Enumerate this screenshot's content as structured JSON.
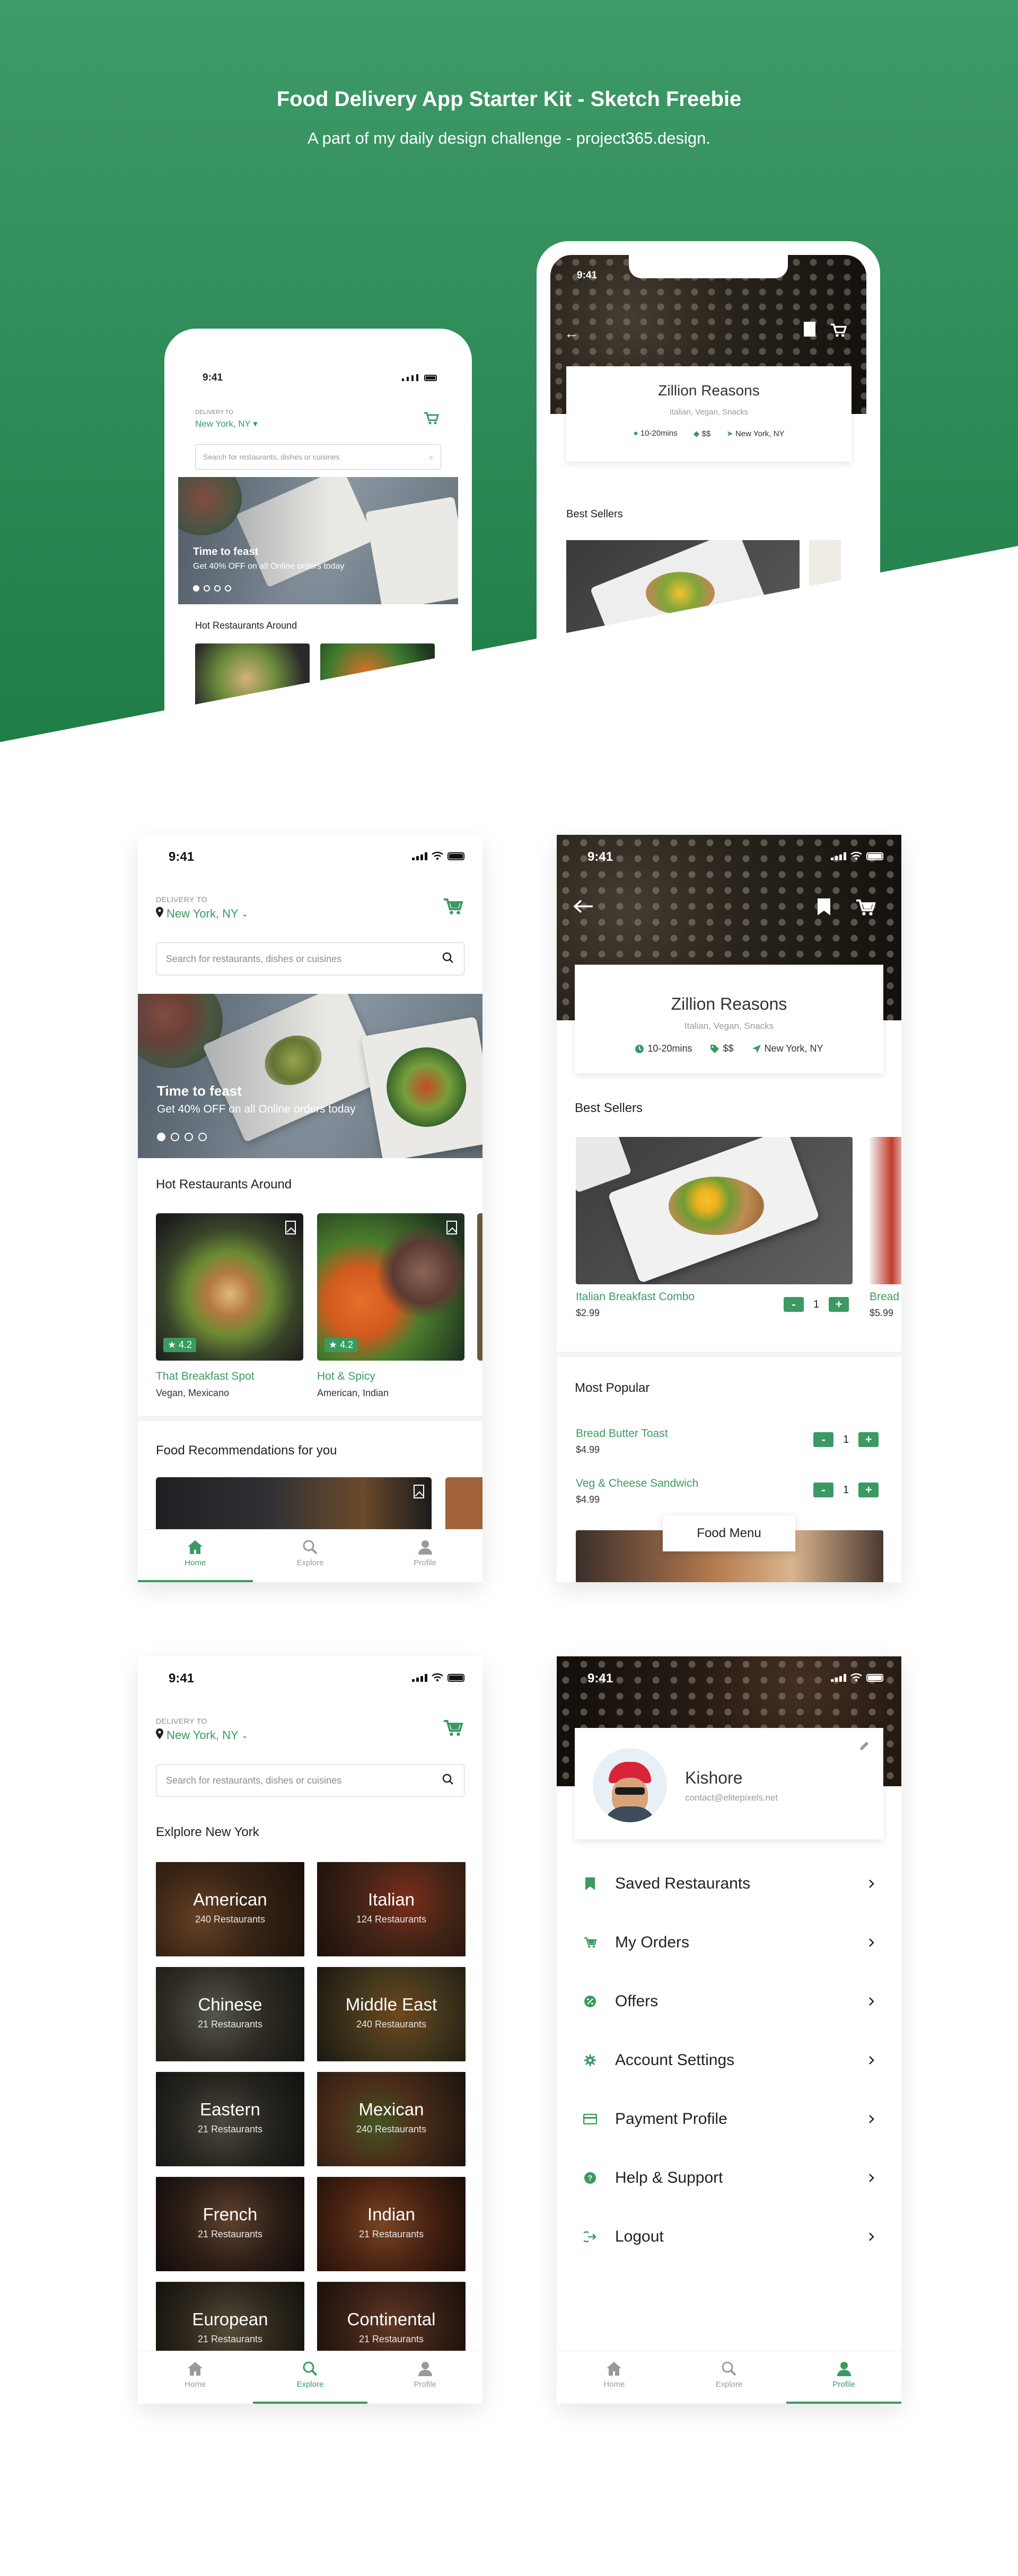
{
  "hero": {
    "title": "Food Delivery App Starter Kit - Sketch Freebie",
    "subtitle": "A part of my daily design challenge - project365.design."
  },
  "status": {
    "time": "9:41"
  },
  "home": {
    "delivery_label": "DELIVERY TO",
    "city": "New York, NY",
    "search_placeholder": "Search for restaurants, dishes or cuisines",
    "banner_title": "Time to feast",
    "banner_subtitle": "Get 40% OFF on all Online orders today",
    "section_hot": "Hot Restaurants Around",
    "restaurants": [
      {
        "name": "That Breakfast Spot",
        "cuisine": "Vegan, Mexicano",
        "rating": "4.2"
      },
      {
        "name": "Hot & Spicy",
        "cuisine": "American, Indian",
        "rating": "4.2"
      }
    ],
    "section_reco": "Food Recommendations for you"
  },
  "hero_preview": {
    "city": "New York, NY",
    "delivery_label": "DELIVERY TO",
    "search_placeholder": "Search for restaurants, dishes or cuisines",
    "banner_title": "Time to feast",
    "banner_subtitle": "Get 40% OFF on all Online orders today",
    "section_hot": "Hot Restaurants Around",
    "restaurant_name": "Zillion Reasons",
    "restaurant_cuisine": "Italian, Vegan, Snacks",
    "best_sellers": "Best Sellers"
  },
  "tabs": {
    "home": "Home",
    "explore": "Explore",
    "profile": "Profile"
  },
  "detail": {
    "name": "Zillion Reasons",
    "cuisine": "Italian, Vegan, Snacks",
    "time": "10-20mins",
    "price_level": "$$",
    "location": "New York, NY",
    "best_sellers": "Best Sellers",
    "best": [
      {
        "name": "Italian Breakfast Combo",
        "price": "$2.99",
        "qty": "1"
      },
      {
        "name": "Bread",
        "price": "$5.99"
      }
    ],
    "most_popular": "Most Popular",
    "popular": [
      {
        "name": "Bread Butter Toast",
        "price": "$4.99",
        "qty": "1"
      },
      {
        "name": "Veg & Cheese Sandwich",
        "price": "$4.99",
        "qty": "1"
      }
    ],
    "menu_button": "Food Menu",
    "minus": "-",
    "plus": "+"
  },
  "explore": {
    "title": "Exlplore New York",
    "categories": [
      {
        "name": "American",
        "count": "240 Restaurants"
      },
      {
        "name": "Italian",
        "count": "124 Restaurants"
      },
      {
        "name": "Chinese",
        "count": "21 Restaurants"
      },
      {
        "name": "Middle East",
        "count": "240 Restaurants"
      },
      {
        "name": "Eastern",
        "count": "21 Restaurants"
      },
      {
        "name": "Mexican",
        "count": "240 Restaurants"
      },
      {
        "name": "French",
        "count": "21 Restaurants"
      },
      {
        "name": "Indian",
        "count": "21 Restaurants"
      },
      {
        "name": "European",
        "count": "21 Restaurants"
      },
      {
        "name": "Continental",
        "count": "21 Restaurants"
      }
    ]
  },
  "profile": {
    "name": "Kishore",
    "email": "contact@elitepixels.net",
    "menu": [
      {
        "label": "Saved Restaurants",
        "icon": "bookmark-icon"
      },
      {
        "label": "My Orders",
        "icon": "cart-icon"
      },
      {
        "label": "Offers",
        "icon": "percent-icon"
      },
      {
        "label": "Account Settings",
        "icon": "gear-icon"
      },
      {
        "label": "Payment Profile",
        "icon": "card-icon"
      },
      {
        "label": "Help & Support",
        "icon": "help-icon"
      },
      {
        "label": "Logout",
        "icon": "logout-icon"
      }
    ]
  },
  "colors": {
    "accent": "#3a9a62",
    "hero_top": "#3f9a69",
    "hero_bottom": "#1f7d47"
  }
}
